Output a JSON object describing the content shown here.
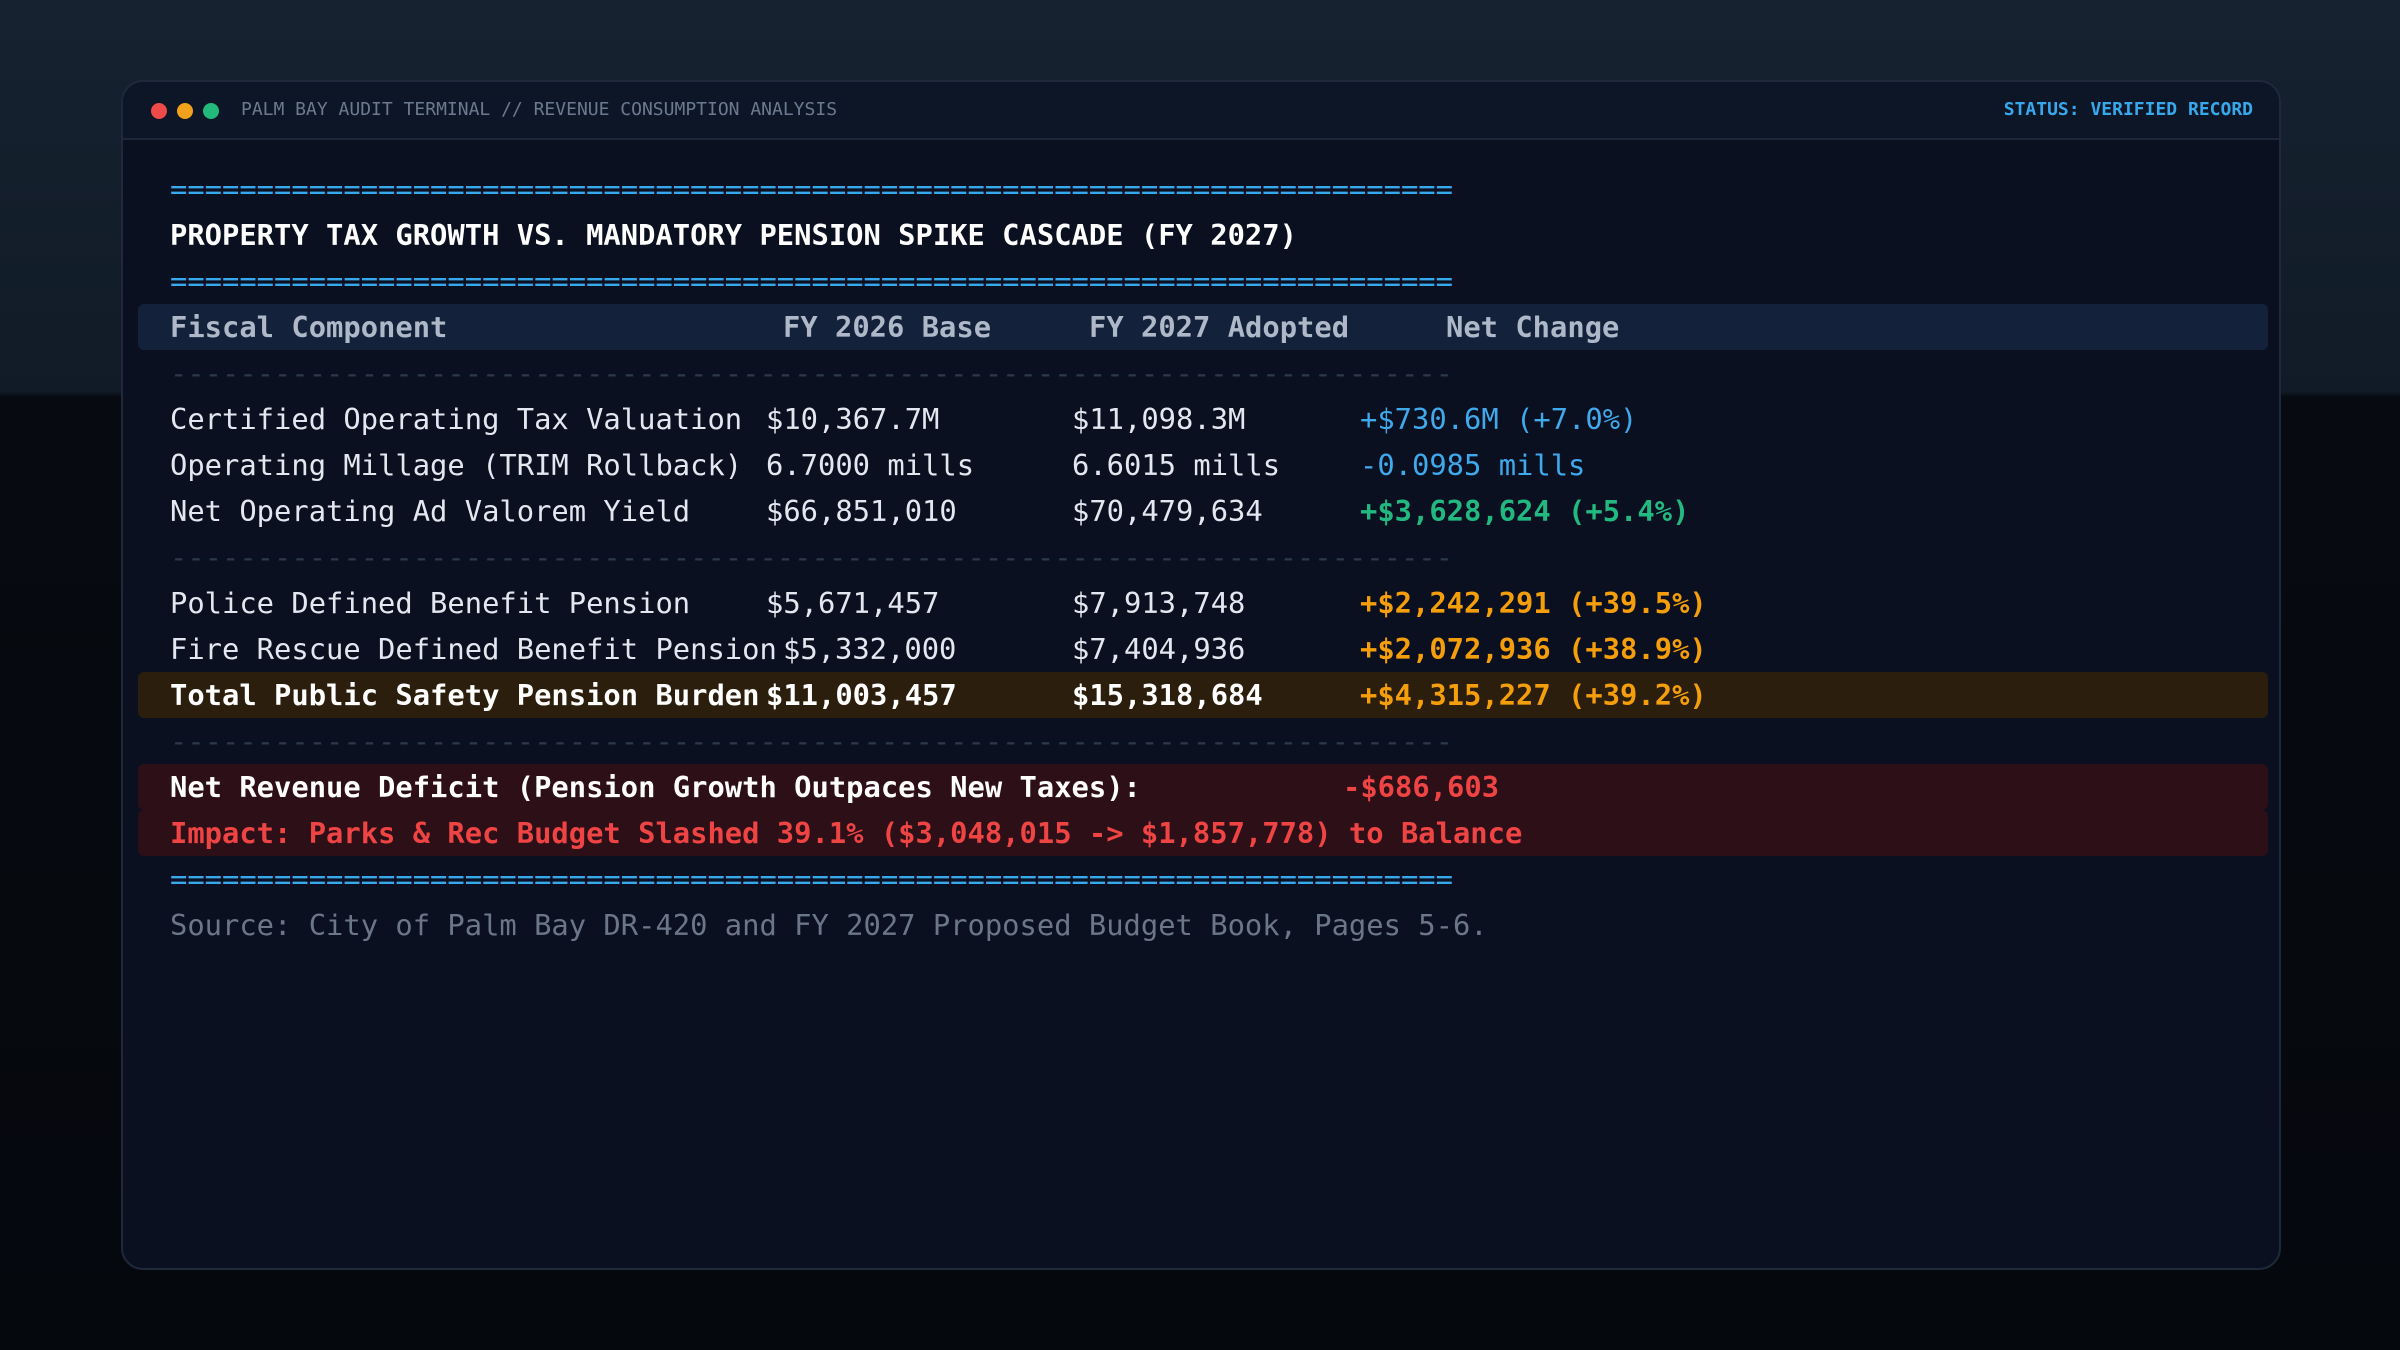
{
  "window": {
    "title": "PALM BAY AUDIT TERMINAL // REVENUE CONSUMPTION ANALYSIS",
    "status": "STATUS: VERIFIED RECORD"
  },
  "report": {
    "double_rule": "==========================================================================",
    "single_rule": "--------------------------------------------------------------------------",
    "title": "PROPERTY TAX GROWTH VS. MANDATORY PENSION SPIKE CASCADE (FY 2027)",
    "headers": [
      "Fiscal Component",
      "FY 2026 Base",
      "FY 2027 Adopted",
      "Net Change"
    ],
    "revenue_rows": [
      {
        "component": "Certified Operating Tax Valuation",
        "base": "$10,367.7M",
        "adopted": "$11,098.3M",
        "change": "+$730.6M (+7.0%)"
      },
      {
        "component": "Operating Millage (TRIM Rollback)",
        "base": "6.7000 mills",
        "adopted": "6.6015 mills",
        "change": "-0.0985 mills"
      },
      {
        "component": "Net Operating Ad Valorem Yield",
        "base": "$66,851,010",
        "adopted": "$70,479,634",
        "change": "+$3,628,624 (+5.4%)"
      }
    ],
    "pension_rows": [
      {
        "component": "Police Defined Benefit Pension",
        "base": "$5,671,457",
        "adopted": "$7,913,748",
        "change": "+$2,242,291 (+39.5%)"
      },
      {
        "component": "Fire Rescue Defined Benefit Pension",
        "base": "$5,332,000",
        "adopted": "$7,404,936",
        "change": "+$2,072,936 (+38.9%)"
      }
    ],
    "total_row": {
      "component": "Total Public Safety Pension Burden",
      "base": "$11,003,457",
      "adopted": "$15,318,684",
      "change": "+$4,315,227 (+39.2%)"
    },
    "deficit": {
      "label": "Net Revenue Deficit (Pension Growth Outpaces New Taxes):",
      "value": "-$686,603"
    },
    "impact": "Impact: Parks & Rec Budget Slashed 39.1% ($3,048,015 -> $1,857,778) to Balance",
    "source": "Source: City of Palm Bay DR-420 and FY 2027 Proposed Budget Book, Pages 5-6."
  },
  "colors": {
    "accent_blue": "#38a8ec",
    "positive_green": "#22b981",
    "pension_orange": "#f59e0b",
    "deficit_red": "#ef4444"
  }
}
